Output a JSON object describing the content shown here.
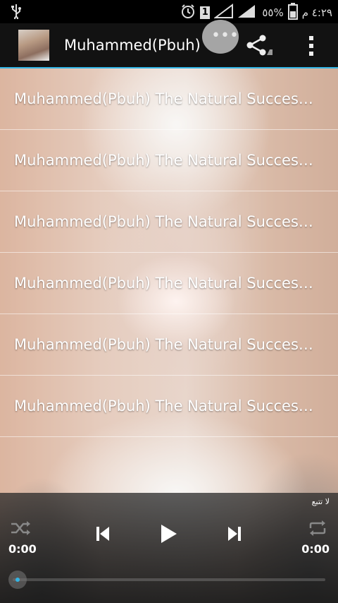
{
  "status_bar": {
    "time": "٤:٢٩ م",
    "battery": "٥٥%",
    "notification_badge": "1",
    "icons": [
      "usb-icon",
      "alarm-icon",
      "signal-icon",
      "battery-icon"
    ]
  },
  "action_bar": {
    "title": "Muhammed(Pbuh)",
    "icons": [
      "avatar",
      "chat-icon",
      "share-icon",
      "overflow-menu-icon"
    ]
  },
  "tracks": [
    {
      "title": "Muhammed(Pbuh) The Natural Successor to Christ(Pbuh)"
    },
    {
      "title": "Muhammed(Pbuh) The Natural Successor to Christ(Pbuh)"
    },
    {
      "title": "Muhammed(Pbuh) The Natural Successor to Christ(Pbuh)"
    },
    {
      "title": "Muhammed(Pbuh) The Natural Successor to Christ(Pbuh)"
    },
    {
      "title": "Muhammed(Pbuh) The Natural Successor to Christ(Pbuh)"
    },
    {
      "title": "Muhammed(Pbuh) The Natural Successor to Christ(Pbuh)"
    }
  ],
  "player": {
    "follow_label": "لا تتبع",
    "elapsed": "0:00",
    "duration": "0:00",
    "progress": 0,
    "accent": "#33b5e5",
    "icons": [
      "shuffle-icon",
      "previous-icon",
      "play-icon",
      "next-icon",
      "repeat-icon"
    ]
  }
}
